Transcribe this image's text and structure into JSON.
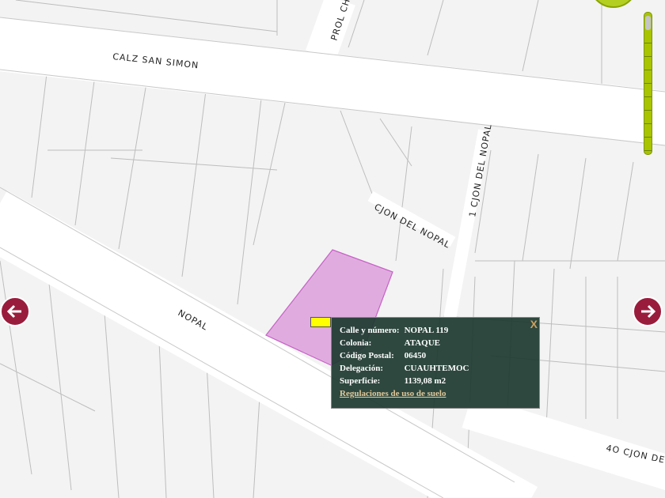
{
  "streets": {
    "calz_san_simon": "CALZ SAN SIMON",
    "prol_ch": "PROL CH",
    "cjon_del_nopal": "CJON DEL NOPAL",
    "uno_cjon_del_nopal": "1 CJON DEL NOPAL",
    "nopal": "NOPAL",
    "cuarto_cjon": "4O CJON DE"
  },
  "popup": {
    "rows": [
      {
        "label": "Calle y número:",
        "value": "NOPAL 119"
      },
      {
        "label": "Colonia:",
        "value": "ATAQUE"
      },
      {
        "label": "Código Postal:",
        "value": "06450"
      },
      {
        "label": "Delegación:",
        "value": "CUAUHTEMOC"
      },
      {
        "label": "Superficie:",
        "value": "1139,08 m2"
      }
    ],
    "link": "Regulaciones de uso de suelo",
    "close": "X"
  },
  "colors": {
    "parcel": "#e0acdf",
    "popup_bg": "#1e3a30",
    "arrow": "#9a1c3c",
    "zoom": "#a8c400"
  },
  "zoom_level_fraction": 1.0
}
